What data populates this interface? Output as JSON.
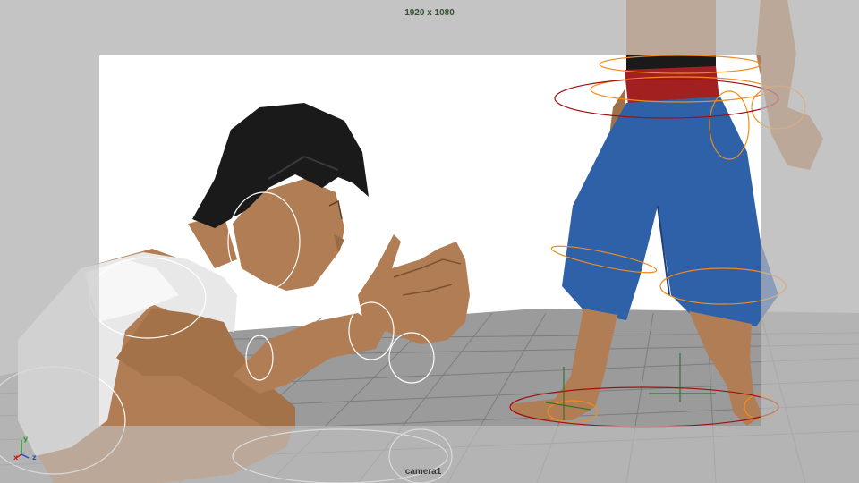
{
  "viewport": {
    "resolution_gate_label": "1920 x 1080",
    "camera_name": "camera1",
    "axes": {
      "x": "x",
      "y": "y",
      "z": "z"
    }
  },
  "scene": {
    "characters": [
      "crouching-character",
      "standing-character"
    ],
    "colors": {
      "background_gray": "#c4c4c4",
      "render_background": "#ffffff",
      "floor_grid": "#8a8a8a",
      "skin": "#b07d55",
      "hair": "#1a1a1a",
      "shirt": "#eaeaea",
      "pants": "#2f61a8",
      "sash": "#a32020",
      "control_orange": "#f08c1e",
      "control_red": "#a01010",
      "control_white": "#ffffff"
    }
  }
}
